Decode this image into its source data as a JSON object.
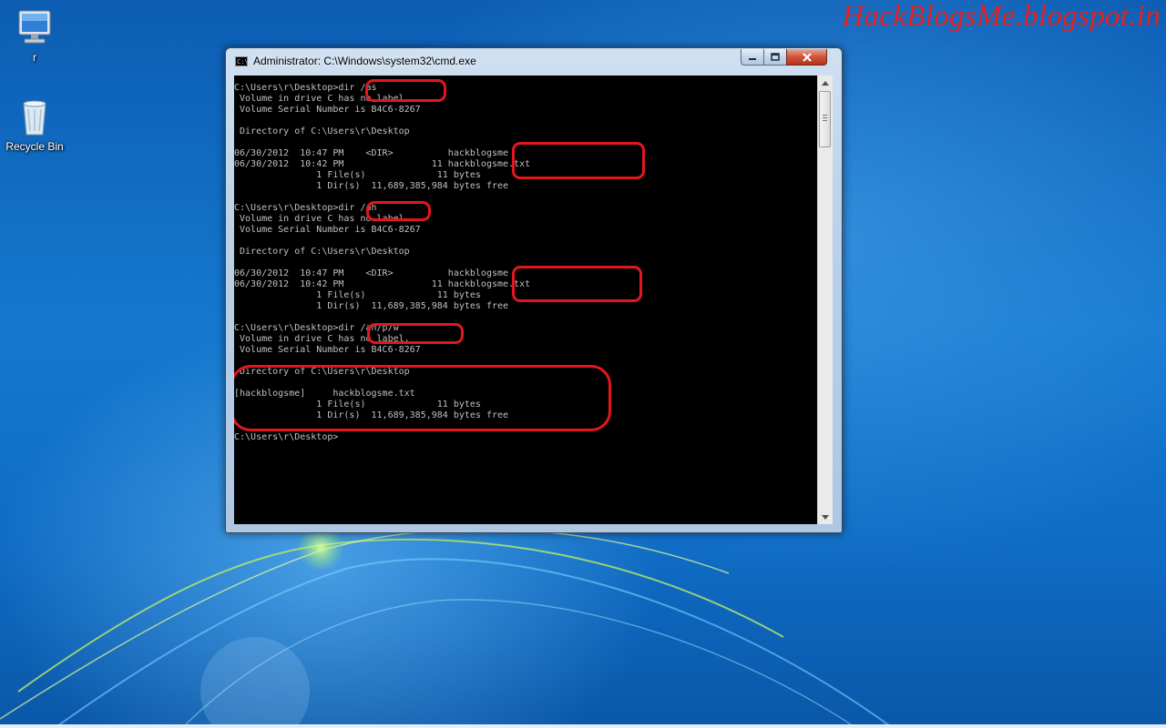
{
  "watermark": "HackBlogsMe.blogspot.in",
  "desktop": {
    "icons": [
      {
        "name": "user-folder",
        "label": "r",
        "icon": "computer-monitor-icon"
      },
      {
        "name": "recycle-bin",
        "label": "Recycle Bin",
        "icon": "recycle-bin-icon"
      }
    ]
  },
  "window": {
    "title": "Administrator: C:\\Windows\\system32\\cmd.exe",
    "icon_glyph": "C:\\",
    "console_lines": [
      "C:\\Users\\r\\Desktop>dir /as",
      " Volume in drive C has no label.",
      " Volume Serial Number is B4C6-8267",
      "",
      " Directory of C:\\Users\\r\\Desktop",
      "",
      "06/30/2012  10:47 PM    <DIR>          hackblogsme",
      "06/30/2012  10:42 PM                11 hackblogsme.txt",
      "               1 File(s)             11 bytes",
      "               1 Dir(s)  11,689,385,984 bytes free",
      "",
      "C:\\Users\\r\\Desktop>dir /ah",
      " Volume in drive C has no label.",
      " Volume Serial Number is B4C6-8267",
      "",
      " Directory of C:\\Users\\r\\Desktop",
      "",
      "06/30/2012  10:47 PM    <DIR>          hackblogsme",
      "06/30/2012  10:42 PM                11 hackblogsme.txt",
      "               1 File(s)             11 bytes",
      "               1 Dir(s)  11,689,385,984 bytes free",
      "",
      "C:\\Users\\r\\Desktop>dir /ah/p/w",
      " Volume in drive C has no label.",
      " Volume Serial Number is B4C6-8267",
      "",
      " Directory of C:\\Users\\r\\Desktop",
      "",
      "[hackblogsme]     hackblogsme.txt",
      "               1 File(s)             11 bytes",
      "               1 Dir(s)  11,689,385,984 bytes free",
      "",
      "C:\\Users\\r\\Desktop>"
    ]
  },
  "colors": {
    "console_bg": "#000000",
    "console_fg": "#c0c0c0",
    "annotation": "#e4161d",
    "watermark": "#e52020"
  }
}
